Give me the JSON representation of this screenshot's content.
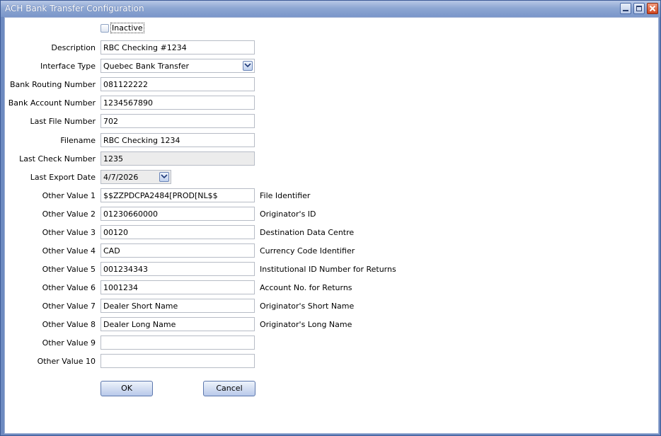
{
  "window": {
    "title": "ACH Bank Transfer Configuration"
  },
  "inactive": {
    "label": "Inactive",
    "checked": false
  },
  "fields": {
    "description": {
      "label": "Description",
      "value": "RBC Checking #1234"
    },
    "interface_type": {
      "label": "Interface Type",
      "value": "Quebec Bank Transfer"
    },
    "routing": {
      "label": "Bank Routing Number",
      "value": "081122222"
    },
    "account": {
      "label": "Bank Account Number",
      "value": "1234567890"
    },
    "last_file": {
      "label": "Last File Number",
      "value": "702"
    },
    "filename": {
      "label": "Filename",
      "value": "RBC Checking 1234"
    },
    "last_check": {
      "label": "Last Check Number",
      "value": "1235"
    },
    "last_export": {
      "label": "Last Export Date",
      "value": "4/7/2026"
    }
  },
  "other_values": [
    {
      "label": "Other Value 1",
      "value": "$$ZZPDCPA2484[PROD[NL$$",
      "desc": "File Identifier"
    },
    {
      "label": "Other Value 2",
      "value": "01230660000",
      "desc": "Originator's ID"
    },
    {
      "label": "Other Value 3",
      "value": "00120",
      "desc": "Destination Data Centre"
    },
    {
      "label": "Other Value 4",
      "value": "CAD",
      "desc": "Currency Code Identifier"
    },
    {
      "label": "Other Value 5",
      "value": "001234343",
      "desc": "Institutional ID Number for Returns"
    },
    {
      "label": "Other Value 6",
      "value": "1001234",
      "desc": "Account No. for Returns"
    },
    {
      "label": "Other Value 7",
      "value": "Dealer Short Name",
      "desc": "Originator's Short Name"
    },
    {
      "label": "Other Value 8",
      "value": "Dealer Long Name",
      "desc": "Originator's Long Name"
    },
    {
      "label": "Other Value 9",
      "value": "",
      "desc": ""
    },
    {
      "label": "Other Value 10",
      "value": "",
      "desc": ""
    }
  ],
  "buttons": {
    "ok": "OK",
    "cancel": "Cancel"
  },
  "colors": {
    "titlebar": "#8ea7d3",
    "border": "#3c5a96",
    "close_button": "#d0451f"
  }
}
